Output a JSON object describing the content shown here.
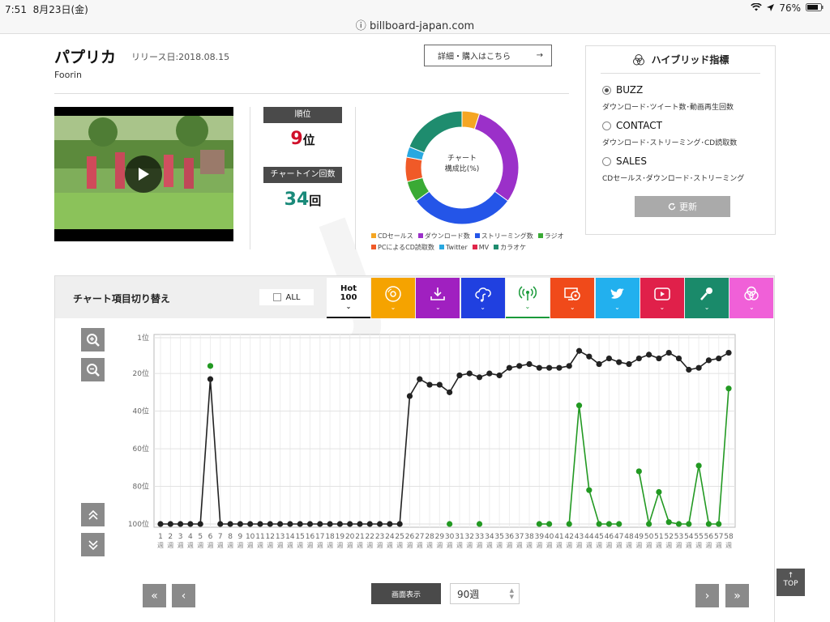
{
  "status": {
    "time": "7:51",
    "date": "8月23日(金)",
    "battery": "76%"
  },
  "url": "billboard-japan.com",
  "song": {
    "title": "パプリカ",
    "release_date": "リリース日:2018.08.15",
    "artist": "Foorin",
    "buy_label": "詳細・購入はこちら",
    "buy_arrow": "→"
  },
  "rank": {
    "label": "順位",
    "value": "9",
    "unit": "位",
    "chartin_label": "チャートイン回数",
    "chartin_value": "34",
    "chartin_unit": "回"
  },
  "composition": {
    "center_line1": "チャート",
    "center_line2": "構成比(%)",
    "segments": [
      {
        "name": "CDセールス",
        "color": "#f5a623",
        "value": 5
      },
      {
        "name": "ダウンロード数",
        "color": "#9b30c9",
        "value": 30
      },
      {
        "name": "ストリーミング数",
        "color": "#2455e8",
        "value": 30
      },
      {
        "name": "ラジオ",
        "color": "#3aaa35",
        "value": 6
      },
      {
        "name": "PCによるCD読取数",
        "color": "#f05a28",
        "value": 7
      },
      {
        "name": "Twitter",
        "color": "#29a8e0",
        "value": 3
      },
      {
        "name": "MV",
        "color": "#e0264a",
        "value": 0
      },
      {
        "name": "カラオケ",
        "color": "#1e8c6e",
        "value": 19
      }
    ]
  },
  "hybrid": {
    "title": "ハイブリッド指標",
    "options": [
      {
        "label": "BUZZ",
        "desc": "ダウンロード･ツイート数･動画再生回数",
        "selected": true
      },
      {
        "label": "CONTACT",
        "desc": "ダウンロード･ストリーミング･CD読取数",
        "selected": false
      },
      {
        "label": "SALES",
        "desc": "CDセールス･ダウンロード･ストリーミング",
        "selected": false
      }
    ],
    "update_label": "更新",
    "update_icon": "refresh-icon"
  },
  "chart_switch": {
    "label": "チャート項目切り替え",
    "all_label": "ALL",
    "hot_label_1": "Hot",
    "hot_label_2": "100",
    "tabs": [
      {
        "name": "cd",
        "icon": "cd-icon",
        "color": "#f5a300"
      },
      {
        "name": "download",
        "icon": "download-icon",
        "color": "#a020c0"
      },
      {
        "name": "streaming",
        "icon": "cloud-music-icon",
        "color": "#2040e0"
      },
      {
        "name": "radio",
        "icon": "radio-antenna-icon",
        "color": "#ffffff"
      },
      {
        "name": "pc-cd-read",
        "icon": "pc-cd-icon",
        "color": "#f04a1a"
      },
      {
        "name": "twitter",
        "icon": "twitter-icon",
        "color": "#22b0ee"
      },
      {
        "name": "mv",
        "icon": "play-icon",
        "color": "#e0204a"
      },
      {
        "name": "karaoke",
        "icon": "microphone-icon",
        "color": "#1a8a6a"
      },
      {
        "name": "look",
        "icon": "circles-icon",
        "color": "#f060d8"
      }
    ]
  },
  "chart_data": {
    "type": "line",
    "y_reversed": true,
    "ylim": [
      1,
      100
    ],
    "y_ticks": [
      1,
      20,
      40,
      60,
      80,
      100
    ],
    "y_tick_labels": [
      "1位",
      "20位",
      "40位",
      "60位",
      "80位",
      "100位"
    ],
    "x": [
      1,
      2,
      3,
      4,
      5,
      6,
      7,
      8,
      9,
      10,
      11,
      12,
      13,
      14,
      15,
      16,
      17,
      18,
      19,
      20,
      21,
      22,
      23,
      24,
      25,
      26,
      27,
      28,
      29,
      30,
      31,
      32,
      33,
      34,
      35,
      36,
      37,
      38,
      39,
      40,
      41,
      42,
      43,
      44,
      45,
      46,
      47,
      48,
      49,
      50,
      51,
      52,
      53,
      54,
      55,
      56,
      57,
      58
    ],
    "x_unit": "週",
    "grid": true,
    "series": [
      {
        "color": "#222222",
        "values": [
          100,
          100,
          100,
          100,
          100,
          23,
          100,
          100,
          100,
          100,
          100,
          100,
          100,
          100,
          100,
          100,
          100,
          100,
          100,
          100,
          100,
          100,
          100,
          100,
          100,
          32,
          23,
          26,
          26,
          30,
          21,
          20,
          22,
          20,
          21,
          17,
          16,
          15,
          17,
          17,
          17,
          16,
          8,
          11,
          15,
          12,
          14,
          15,
          12,
          10,
          12,
          9,
          12,
          18,
          17,
          13,
          12,
          9
        ]
      },
      {
        "color": "#229922",
        "values": [
          null,
          null,
          null,
          null,
          null,
          16,
          null,
          null,
          null,
          null,
          null,
          null,
          null,
          null,
          null,
          null,
          null,
          null,
          null,
          null,
          null,
          null,
          null,
          null,
          null,
          null,
          null,
          null,
          null,
          100,
          null,
          null,
          100,
          null,
          null,
          null,
          null,
          null,
          100,
          100,
          null,
          100,
          37,
          82,
          100,
          100,
          100,
          null,
          72,
          100,
          83,
          99,
          100,
          100,
          69,
          100,
          100,
          28
        ]
      }
    ]
  },
  "controls": {
    "display_label": "画面表示",
    "weeks_value": "90週",
    "top_label": "TOP",
    "top_arrow": "↑",
    "first": "«",
    "prev": "‹",
    "next": "›",
    "last": "»"
  }
}
